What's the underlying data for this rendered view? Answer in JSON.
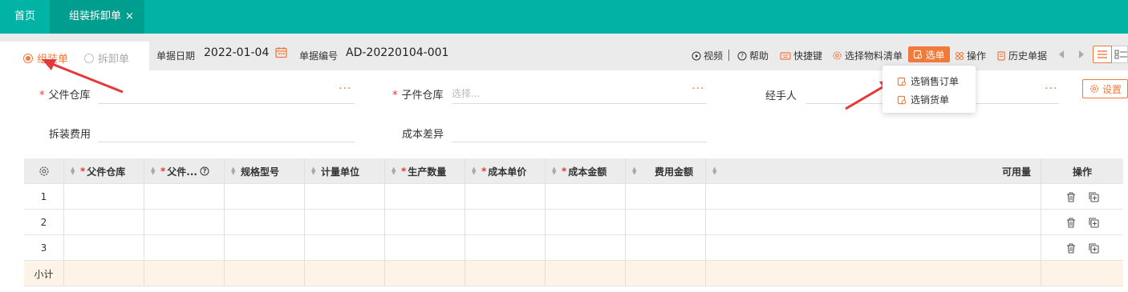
{
  "tabs": {
    "home": "首页",
    "active": "组装拆卸单",
    "close": "×"
  },
  "header": {
    "radio_assembly": "组装单",
    "radio_disassembly": "拆卸单",
    "date_label": "单据日期",
    "date_value": "2022-01-04",
    "number_label": "单据编号",
    "number_value": "AD-20220104-001"
  },
  "toolbar": {
    "video": "视频",
    "help": "帮助",
    "shortcut": "快捷键",
    "select_bom": "选择物料清单",
    "select_doc": "选单",
    "operation": "操作",
    "history": "历史单据"
  },
  "dropdown": {
    "items": [
      "选销售订单",
      "选销货单"
    ]
  },
  "form": {
    "parent_warehouse": "父件仓库",
    "child_warehouse": "子件仓库",
    "child_warehouse_placeholder": "选择...",
    "handler": "经手人",
    "disassembly_fee": "拆装费用",
    "cost_difference": "成本差异",
    "settings": "设置"
  },
  "table": {
    "headers": {
      "parent_warehouse": "父件仓库",
      "parent_item": "父件...",
      "spec": "规格型号",
      "unit": "计量单位",
      "quantity": "生产数量",
      "unit_cost": "成本单价",
      "cost_amount": "成本金额",
      "fee_amount": "费用金额",
      "available": "可用量",
      "operation": "操作"
    },
    "rows": [
      "1",
      "2",
      "3"
    ],
    "subtotal": "小计"
  },
  "colors": {
    "topbar": "#00b3a4",
    "accent": "#f07a3c",
    "required": "#e5383b"
  }
}
